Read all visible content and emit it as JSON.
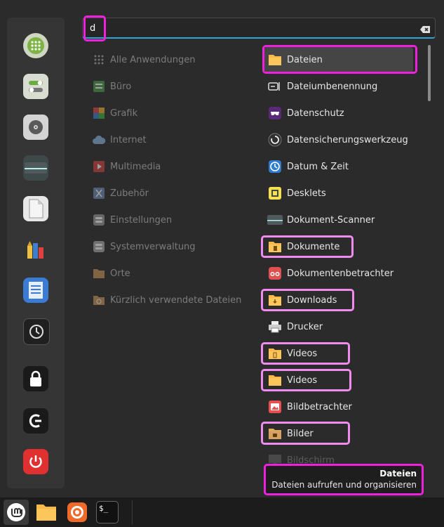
{
  "search": {
    "value": "d",
    "placeholder": ""
  },
  "favorites": [
    {
      "name": "apps-grid-icon",
      "label": ""
    },
    {
      "name": "toggle-settings-icon",
      "label": ""
    },
    {
      "name": "disk-icon",
      "label": ""
    },
    {
      "name": "scanner-icon",
      "label": ""
    },
    {
      "name": "document-icon",
      "label": ""
    },
    {
      "name": "paint-tools-icon",
      "label": ""
    },
    {
      "name": "text-document-icon",
      "label": ""
    },
    {
      "name": "timeshift-icon",
      "label": ""
    },
    {
      "name": "lock-icon",
      "label": ""
    },
    {
      "name": "logout-icon",
      "label": ""
    },
    {
      "name": "power-icon",
      "label": ""
    }
  ],
  "categories": [
    {
      "label": "Alle Anwendungen",
      "icon": "all-apps-icon"
    },
    {
      "label": "Büro",
      "icon": "office-icon"
    },
    {
      "label": "Grafik",
      "icon": "graphics-icon"
    },
    {
      "label": "Internet",
      "icon": "cloud-icon"
    },
    {
      "label": "Multimedia",
      "icon": "play-icon"
    },
    {
      "label": "Zubehör",
      "icon": "scissors-icon"
    },
    {
      "label": "Einstellungen",
      "icon": "settings-icon"
    },
    {
      "label": "Systemverwaltung",
      "icon": "system-icon"
    },
    {
      "label": "Orte",
      "icon": "folder-icon"
    },
    {
      "label": "Kürzlich verwendete Dateien",
      "icon": "recent-folder-icon"
    }
  ],
  "apps": [
    {
      "label": "Dateien",
      "icon": "folder-icon"
    },
    {
      "label": "Dateiumbenennung",
      "icon": "rename-icon"
    },
    {
      "label": "Datenschutz",
      "icon": "privacy-mask-icon"
    },
    {
      "label": "Datensicherungswerkzeug",
      "icon": "backup-icon"
    },
    {
      "label": "Datum & Zeit",
      "icon": "clock-icon"
    },
    {
      "label": "Desklets",
      "icon": "desklets-icon"
    },
    {
      "label": "Dokument-Scanner",
      "icon": "scanner-icon"
    },
    {
      "label": "Dokumente",
      "icon": "documents-folder-icon"
    },
    {
      "label": "Dokumentenbetrachter",
      "icon": "glasses-icon"
    },
    {
      "label": "Downloads",
      "icon": "downloads-folder-icon"
    },
    {
      "label": "Drucker",
      "icon": "printer-icon"
    },
    {
      "label": "Videos",
      "icon": "videos-folder-icon"
    },
    {
      "label": "Videos",
      "icon": "folder-icon"
    },
    {
      "label": "Bildbetrachter",
      "icon": "image-viewer-icon"
    },
    {
      "label": "Bilder",
      "icon": "pictures-folder-icon"
    },
    {
      "label": "Bildschirm",
      "icon": "display-icon"
    }
  ],
  "tooltip": {
    "title": "Dateien",
    "description": "Dateien aufrufen und organisieren"
  },
  "taskbar": [
    {
      "name": "mint-menu-icon"
    },
    {
      "name": "files-icon"
    },
    {
      "name": "firefox-icon"
    },
    {
      "name": "terminal-icon",
      "label": "$_"
    }
  ]
}
